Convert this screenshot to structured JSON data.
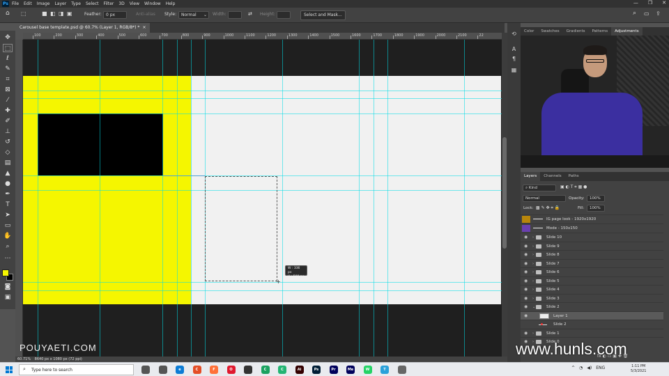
{
  "menubar": {
    "app_icon": "Ps",
    "items": [
      "File",
      "Edit",
      "Image",
      "Layer",
      "Type",
      "Select",
      "Filter",
      "3D",
      "View",
      "Window",
      "Help"
    ],
    "window_controls": [
      "—",
      "❐",
      "✕"
    ]
  },
  "options_bar": {
    "feather_label": "Feather:",
    "feather_value": "0 px",
    "antialias_label": "Anti-alias",
    "style_label": "Style:",
    "style_value": "Normal",
    "width_label": "Width:",
    "height_label": "Height:",
    "select_mask_label": "Select and Mask..."
  },
  "document_tab": {
    "title": "Carousel base template.psd @ 60.7% (Layer 1, RGB/8*) *",
    "close": "×"
  },
  "ruler_h_ticks": [
    "100",
    "200",
    "300",
    "400",
    "500",
    "600",
    "700",
    "800",
    "900",
    "1000",
    "1100",
    "1200",
    "1300",
    "1400",
    "1500",
    "1600",
    "1700",
    "1800",
    "1900",
    "2000",
    "2100",
    "22"
  ],
  "selection_tip": {
    "w": "W :  336 px",
    "h": "H :  500 px"
  },
  "watermarks": {
    "pouya": "POUYAETI.COM",
    "hunls": "www.hunls.com"
  },
  "status_bar": {
    "zoom": "60.71%",
    "doc_size": "8640 px x 1080 px (72 ppi)"
  },
  "panel_tabs": {
    "items": [
      "Color",
      "Swatches",
      "Gradients",
      "Patterns",
      "Adjustments"
    ],
    "active": "Adjustments"
  },
  "layers_panel": {
    "tabs": [
      "Layers",
      "Channels",
      "Paths"
    ],
    "active_tab": "Layers",
    "filter_kind": "Kind",
    "blend_mode": "Normal",
    "opacity_label": "Opacity:",
    "opacity_value": "100%",
    "lock_label": "Lock:",
    "fill_label": "Fill:",
    "fill_value": "100%",
    "layers": [
      {
        "name": "IG page look - 1920x1920",
        "kind": "guide",
        "color": "#b8860b"
      },
      {
        "name": "Mode - 150x150",
        "kind": "guide",
        "color": "#6a3fb0"
      },
      {
        "name": "Slide 10",
        "kind": "group"
      },
      {
        "name": "Slide 9",
        "kind": "group"
      },
      {
        "name": "Slide 8",
        "kind": "group"
      },
      {
        "name": "Slide 7",
        "kind": "group"
      },
      {
        "name": "Slide 6",
        "kind": "group"
      },
      {
        "name": "Slide 5",
        "kind": "group"
      },
      {
        "name": "Slide 4",
        "kind": "group"
      },
      {
        "name": "Slide 3",
        "kind": "group"
      },
      {
        "name": "Slide 2",
        "kind": "group-open"
      },
      {
        "name": "Layer 1",
        "kind": "layer-selected"
      },
      {
        "name": "Slide 2",
        "kind": "artboard-child"
      },
      {
        "name": "Slide 1",
        "kind": "group"
      },
      {
        "name": "Slide 0",
        "kind": "group"
      }
    ]
  },
  "taskbar": {
    "search_placeholder": "Type here to search",
    "apps": [
      {
        "label": "",
        "color": "#555"
      },
      {
        "label": "",
        "color": "#555"
      },
      {
        "label": "e",
        "color": "#0c7cd5"
      },
      {
        "label": "C",
        "color": "#e44d26"
      },
      {
        "label": "F",
        "color": "#ff7139"
      },
      {
        "label": "O",
        "color": "#e0192f"
      },
      {
        "label": "",
        "color": "#333"
      },
      {
        "label": "C",
        "color": "#1aa260"
      },
      {
        "label": "C",
        "color": "#22b573"
      },
      {
        "label": "Ai",
        "color": "#330000"
      },
      {
        "label": "Ps",
        "color": "#001e36"
      },
      {
        "label": "Pr",
        "color": "#00005b"
      },
      {
        "label": "Me",
        "color": "#00005b"
      },
      {
        "label": "W",
        "color": "#25d366"
      },
      {
        "label": "T",
        "color": "#2aa1da"
      },
      {
        "label": "",
        "color": "#666"
      }
    ],
    "tray_lang": "ENG",
    "time": "1:11 PM",
    "date": "5/3/2021"
  },
  "colors": {
    "yellow": "#f5f600",
    "guide": "#00dce6",
    "selected_layer": "#5a5a5a"
  }
}
